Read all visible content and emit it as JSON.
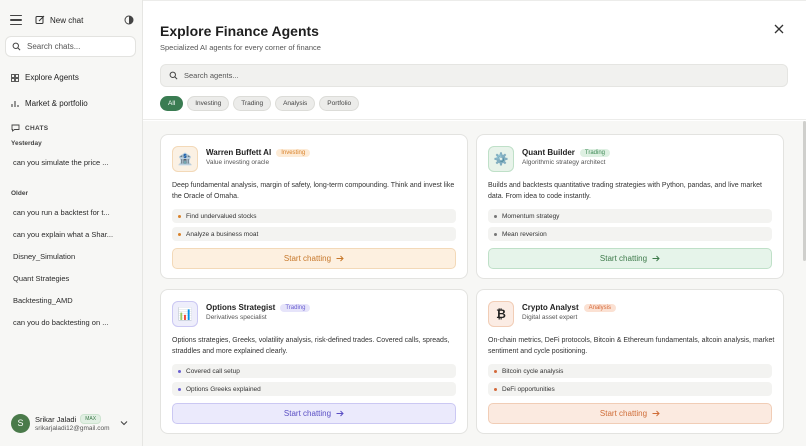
{
  "sidebar": {
    "new_chat": "New chat",
    "search_placeholder": "Search chats...",
    "explore_agents": "Explore Agents",
    "market_portfolio": "Market & portfolio",
    "chats_label": "CHATS",
    "groups": [
      {
        "label": "Yesterday",
        "chats": [
          "can you simulate the price ..."
        ]
      },
      {
        "label": "Older",
        "chats": [
          "can you run a backtest for t...",
          "can you explain what a Shar...",
          "Disney_Simulation",
          "Quant Strategies",
          "Backtesting_AMD",
          "can you do backtesting on ..."
        ]
      }
    ],
    "user": {
      "initial": "S",
      "name": "Srikar Jaladi",
      "badge": "MAX",
      "email": "srikarjaladi12@gmail.com"
    }
  },
  "main": {
    "title": "Explore Finance Agents",
    "subtitle": "Specialized AI agents for every corner of finance",
    "search_placeholder": "Search agents...",
    "filters": [
      "All",
      "Investing",
      "Trading",
      "Analysis",
      "Portfolio"
    ],
    "active_filter": "All"
  },
  "agents": [
    {
      "icon": "bank-icon",
      "glyph": "🏦",
      "name": "Warren Buffett AI",
      "tag": "Investing",
      "role": "Value investing oracle",
      "description": "Deep fundamental analysis, margin of safety, long-term compounding. Think and invest like the Oracle of Omaha.",
      "features": [
        "Find undervalued stocks",
        "Analyze a business moat"
      ],
      "cta": "Start chatting",
      "colors": {
        "icon_bg": "#fbf1e4",
        "tag_bg": "#fdebd6",
        "tag_fg": "#d9822b",
        "btn_bg": "#fdf0e0",
        "btn_border": "#f3d9b8",
        "btn_fg": "#c7782b",
        "dot": "#d9822b"
      }
    },
    {
      "icon": "gear-icon",
      "glyph": "⚙️",
      "name": "Quant Builder",
      "tag": "Trading",
      "role": "Algorithmic strategy architect",
      "description": "Builds and backtests quantitative trading strategies with Python, pandas, and live market data. From idea to code instantly.",
      "features": [
        "Momentum strategy",
        "Mean reversion"
      ],
      "cta": "Start chatting",
      "colors": {
        "icon_bg": "#e8f3ea",
        "tag_bg": "#def0e2",
        "tag_fg": "#3e8a55",
        "btn_bg": "#e6f4ea",
        "btn_border": "#bfe0c8",
        "btn_fg": "#3e7a4b",
        "dot": "#777777"
      }
    },
    {
      "icon": "bar-chart-icon",
      "glyph": "📊",
      "name": "Options Strategist",
      "tag": "Trading",
      "role": "Derivatives specialist",
      "description": "Options strategies, Greeks, volatility analysis, risk-defined trades. Covered calls, spreads, straddles and more explained clearly.",
      "features": [
        "Covered call setup",
        "Options Greeks explained"
      ],
      "cta": "Start chatting",
      "colors": {
        "icon_bg": "#eeeefb",
        "tag_bg": "#e6e4fa",
        "tag_fg": "#6a5fd0",
        "btn_bg": "#ebeafc",
        "btn_border": "#cbc8f3",
        "btn_fg": "#5a4fc4",
        "dot": "#6a5fd0"
      }
    },
    {
      "icon": "bitcoin-icon",
      "glyph": "₿",
      "name": "Crypto Analyst",
      "tag": "Analysis",
      "role": "Digital asset expert",
      "description": "On-chain metrics, DeFi protocols, Bitcoin & Ethereum fundamentals, altcoin analysis, market sentiment and cycle positioning.",
      "features": [
        "Bitcoin cycle analysis",
        "DeFi opportunities"
      ],
      "cta": "Start chatting",
      "colors": {
        "icon_bg": "#fbece4",
        "tag_bg": "#fbe1d3",
        "tag_fg": "#d4693a",
        "btn_bg": "#fbeae0",
        "btn_border": "#f1cdb6",
        "btn_fg": "#cf6d38",
        "dot": "#d4693a"
      }
    }
  ]
}
